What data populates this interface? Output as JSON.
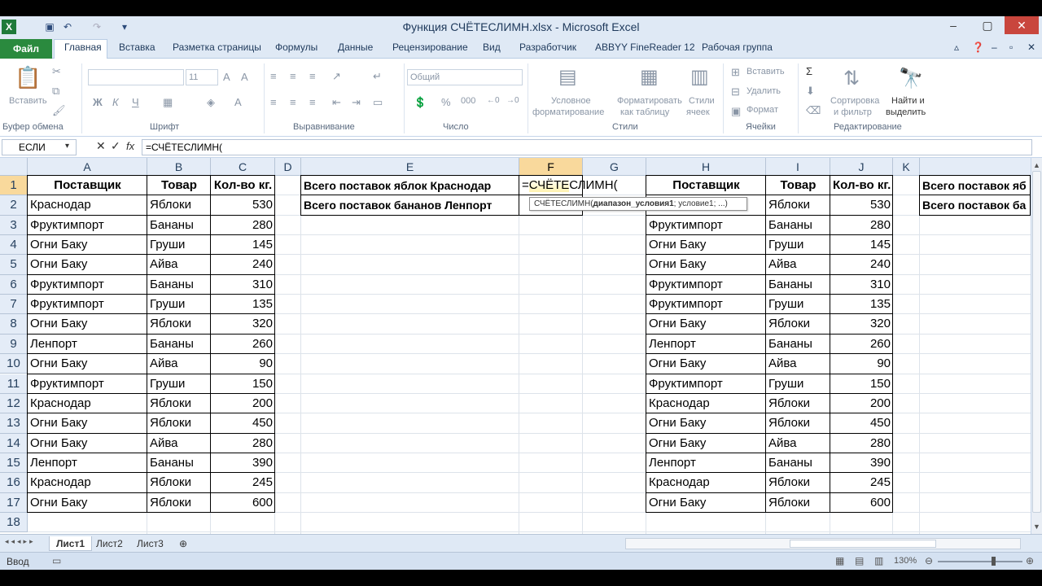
{
  "window": {
    "title": "Функция СЧЁТЕСЛИМН.xlsx  -  Microsoft Excel"
  },
  "tabs": [
    "Файл",
    "Главная",
    "Вставка",
    "Разметка страницы",
    "Формулы",
    "Данные",
    "Рецензирование",
    "Вид",
    "Разработчик",
    "ABBYY FineReader 12",
    "Рабочая группа"
  ],
  "ribbon": {
    "paste": "Вставить",
    "clipboard": "Буфер обмена",
    "font_group": "Шрифт",
    "font_size": "11",
    "bold": "Ж",
    "italic": "К",
    "underline": "Ч",
    "align_group": "Выравнивание",
    "number_format": "Общий",
    "number_group": "Число",
    "cond_format": "Условное",
    "cond_format2": "форматирование",
    "format_table": "Форматировать",
    "format_table2": "как таблицу",
    "cell_styles": "Стили",
    "cell_styles2": "ячеек",
    "styles_group": "Стили",
    "insert": "Вставить",
    "delete": "Удалить",
    "format": "Формат",
    "cells_group": "Ячейки",
    "sort": "Сортировка",
    "sort2": "и фильтр",
    "find": "Найти и",
    "find2": "выделить",
    "editing_group": "Редактирование",
    "sigma": "Σ",
    "percent": "%",
    "thousands": "000"
  },
  "formula_bar": {
    "name_box": "ЕСЛИ",
    "fx": "fx",
    "formula": "=СЧЁТЕСЛИМН("
  },
  "columns": [
    "A",
    "B",
    "C",
    "D",
    "E",
    "F",
    "G",
    "H",
    "I",
    "J",
    "K"
  ],
  "rows": [
    "1",
    "2",
    "3",
    "4",
    "5",
    "6",
    "7",
    "8",
    "9",
    "10",
    "11",
    "12",
    "13",
    "14",
    "15",
    "16",
    "17",
    "18"
  ],
  "table_headers": [
    "Поставщик",
    "Товар",
    "Кол-во кг."
  ],
  "table_rows": [
    [
      "Краснодар",
      "Яблоки",
      "530"
    ],
    [
      "Фруктимпорт",
      "Бананы",
      "280"
    ],
    [
      "Огни Баку",
      "Груши",
      "145"
    ],
    [
      "Огни Баку",
      "Айва",
      "240"
    ],
    [
      "Фруктимпорт",
      "Бананы",
      "310"
    ],
    [
      "Фруктимпорт",
      "Груши",
      "135"
    ],
    [
      "Огни Баку",
      "Яблоки",
      "320"
    ],
    [
      "Ленпорт",
      "Бананы",
      "260"
    ],
    [
      "Огни Баку",
      "Айва",
      "90"
    ],
    [
      "Фруктимпорт",
      "Груши",
      "150"
    ],
    [
      "Краснодар",
      "Яблоки",
      "200"
    ],
    [
      "Огни Баку",
      "Яблоки",
      "450"
    ],
    [
      "Огни Баку",
      "Айва",
      "280"
    ],
    [
      "Ленпорт",
      "Бананы",
      "390"
    ],
    [
      "Краснодар",
      "Яблоки",
      "245"
    ],
    [
      "Огни Баку",
      "Яблоки",
      "600"
    ]
  ],
  "summary": {
    "e1": "Всего поставок яблок Краснодар",
    "e2": "Всего поставок бананов Ленпорт",
    "f1_prefix": "=",
    "f1_highlight": "СЧЁТЕ",
    "f1_rest": "СЛИМН(",
    "l1": "Всего поставок яб",
    "l2": "Всего поставок ба"
  },
  "tooltip": {
    "func": "СЧЁТЕСЛИМН(",
    "arg_bold": "диапазон_условия1",
    "rest": "; условие1; ...)"
  },
  "sheets": [
    "Лист1",
    "Лист2",
    "Лист3"
  ],
  "status": {
    "mode": "Ввод",
    "zoom": "130%"
  }
}
